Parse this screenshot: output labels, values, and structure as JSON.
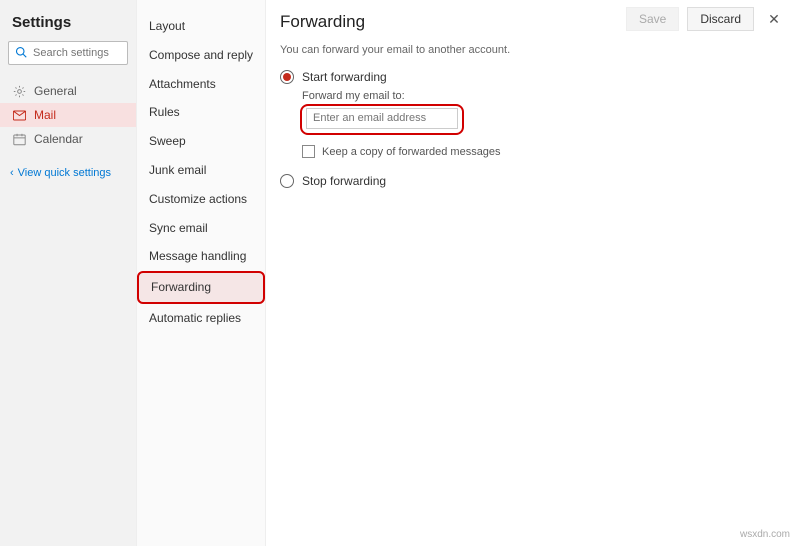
{
  "left": {
    "title": "Settings",
    "search_placeholder": "Search settings",
    "nav": {
      "general": "General",
      "mail": "Mail",
      "calendar": "Calendar",
      "quick": "View quick settings"
    }
  },
  "mid": {
    "items": [
      "Layout",
      "Compose and reply",
      "Attachments",
      "Rules",
      "Sweep",
      "Junk email",
      "Customize actions",
      "Sync email",
      "Message handling",
      "Forwarding",
      "Automatic replies"
    ]
  },
  "main": {
    "title": "Forwarding",
    "save": "Save",
    "discard": "Discard",
    "desc": "You can forward your email to another account.",
    "start": "Start forwarding",
    "fwd_label": "Forward my email to:",
    "email_placeholder": "Enter an email address",
    "keep_copy": "Keep a copy of forwarded messages",
    "stop": "Stop forwarding"
  },
  "watermark": "wsxdn.com"
}
